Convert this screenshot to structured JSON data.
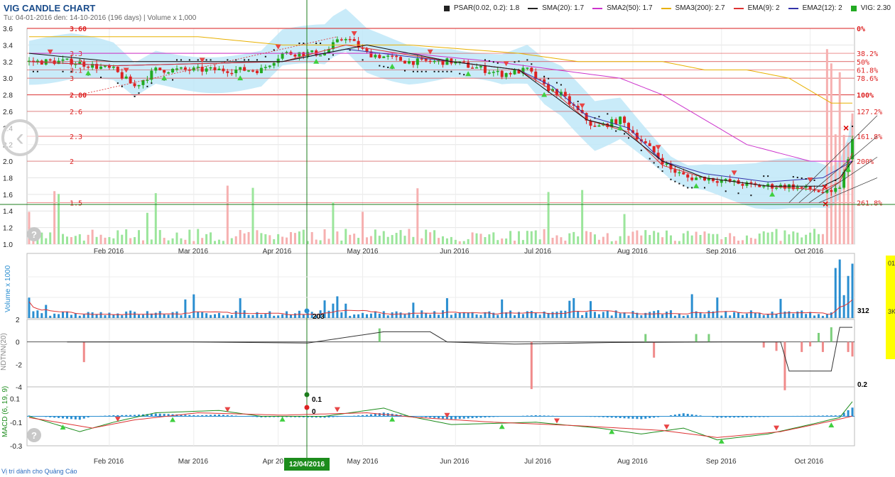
{
  "header": {
    "title": "VIG CANDLE CHART",
    "subtitle": "Tu: 04-01-2016 den: 14-10-2016 (196 days) | Volume x 1,000"
  },
  "legend": [
    {
      "label": "PSAR(0.02, 0.2): 1.8",
      "color": "#222222",
      "kind": "square"
    },
    {
      "label": "SMA(20): 1.7",
      "color": "#222222",
      "kind": "line"
    },
    {
      "label": "SMA2(50): 1.7",
      "color": "#cc33cc",
      "kind": "line"
    },
    {
      "label": "SMA3(200): 2.7",
      "color": "#e8b000",
      "kind": "line"
    },
    {
      "label": "EMA(9): 2",
      "color": "#dd3333",
      "kind": "line"
    },
    {
      "label": "EMA2(12): 2",
      "color": "#3333aa",
      "kind": "line"
    },
    {
      "label": "VIG: 2.30",
      "color": "#22aa22",
      "kind": "square"
    }
  ],
  "footer": {
    "text": "Vị trí dành cho Quảng Cáo"
  },
  "crosshair": {
    "date_label": "12/04/2016"
  },
  "right_panel": {
    "top_text": "01",
    "mid_text": "3K"
  },
  "colors": {
    "up": "#22aa22",
    "down": "#dd2222",
    "fib": "#dd2222",
    "cloud": "#bfe8f8"
  },
  "chart_data": [
    {
      "type": "candlestick",
      "name": "price",
      "ylim": [
        1.0,
        3.6
      ],
      "yticks": [
        "1.0",
        "1.2",
        "1.4",
        "1.6",
        "1.8",
        "2.0",
        "2.2",
        "2.4",
        "2.6",
        "2.8",
        "3.0",
        "3.2",
        "3.4",
        "3.6"
      ],
      "xticks": [
        "Feb 2016",
        "Mar 2016",
        "Apr 2016",
        "May 2016",
        "Jun 2016",
        "Jul 2016",
        "Aug 2016",
        "Sep 2016",
        "Oct 2016"
      ],
      "close_path": [
        [
          0,
          3.2
        ],
        [
          10,
          3.2
        ],
        [
          20,
          3.1
        ],
        [
          25,
          2.9
        ],
        [
          30,
          3.1
        ],
        [
          40,
          3.1
        ],
        [
          55,
          3.1
        ],
        [
          60,
          3.3
        ],
        [
          70,
          3.3
        ],
        [
          72,
          3.4
        ],
        [
          75,
          3.5
        ],
        [
          80,
          3.3
        ],
        [
          90,
          3.2
        ],
        [
          100,
          3.2
        ],
        [
          108,
          3.1
        ],
        [
          112,
          3.05
        ],
        [
          118,
          3.1
        ],
        [
          122,
          2.9
        ],
        [
          126,
          2.8
        ],
        [
          130,
          2.6
        ],
        [
          134,
          2.4
        ],
        [
          140,
          2.5
        ],
        [
          144,
          2.3
        ],
        [
          148,
          2.1
        ],
        [
          152,
          1.9
        ],
        [
          156,
          1.8
        ],
        [
          160,
          1.8
        ],
        [
          166,
          1.75
        ],
        [
          172,
          1.7
        ],
        [
          180,
          1.7
        ],
        [
          186,
          1.65
        ],
        [
          190,
          1.6
        ],
        [
          192,
          1.7
        ],
        [
          194,
          2.0
        ],
        [
          195,
          2.3
        ]
      ],
      "ohlc_last": {
        "close": 2.3
      },
      "fib_levels": [
        {
          "label": "0%",
          "value": 3.6
        },
        {
          "label": "38.2%",
          "value": 3.3
        },
        {
          "label": "50%",
          "value": 3.2
        },
        {
          "label": "61.8%",
          "value": 3.1
        },
        {
          "label": "78.6%",
          "value": 3.0
        },
        {
          "label": "100%",
          "value": 2.8
        },
        {
          "label": "127.2%",
          "value": 2.6
        },
        {
          "label": "161.8%",
          "value": 2.3
        },
        {
          "label": "200%",
          "value": 2.0
        },
        {
          "label": "261.8%",
          "value": 1.5
        }
      ],
      "price_labels": [
        {
          "text": "3.60",
          "value": 3.6
        },
        {
          "text": "3.3",
          "value": 3.3
        },
        {
          "text": "3.2",
          "value": 3.2
        },
        {
          "text": "3.1",
          "value": 3.1
        },
        {
          "text": "3",
          "value": 3.0
        },
        {
          "text": "2.80",
          "value": 2.8
        },
        {
          "text": "2.6",
          "value": 2.6
        },
        {
          "text": "2.3",
          "value": 2.3
        },
        {
          "text": "2",
          "value": 2.0
        },
        {
          "text": "1.5",
          "value": 1.5
        }
      ],
      "sma3_path": [
        [
          0,
          3.5
        ],
        [
          40,
          3.5
        ],
        [
          60,
          3.4
        ],
        [
          90,
          3.4
        ],
        [
          116,
          3.3
        ],
        [
          130,
          3.2
        ],
        [
          150,
          3.2
        ],
        [
          160,
          3.1
        ],
        [
          170,
          3.1
        ],
        [
          180,
          3.0
        ],
        [
          190,
          2.7
        ],
        [
          195,
          2.7
        ]
      ],
      "sma2_path": [
        [
          0,
          3.3
        ],
        [
          40,
          3.3
        ],
        [
          60,
          3.3
        ],
        [
          90,
          3.3
        ],
        [
          110,
          3.2
        ],
        [
          125,
          3.1
        ],
        [
          140,
          3.0
        ],
        [
          150,
          2.8
        ],
        [
          160,
          2.5
        ],
        [
          170,
          2.2
        ],
        [
          185,
          2.0
        ],
        [
          195,
          2.0
        ]
      ],
      "sma_path": [
        [
          0,
          3.3
        ],
        [
          20,
          3.2
        ],
        [
          60,
          3.2
        ],
        [
          80,
          3.4
        ],
        [
          100,
          3.2
        ],
        [
          116,
          3.1
        ],
        [
          124,
          2.8
        ],
        [
          132,
          2.5
        ],
        [
          140,
          2.4
        ],
        [
          150,
          2.0
        ],
        [
          160,
          1.8
        ],
        [
          175,
          1.7
        ],
        [
          188,
          1.7
        ],
        [
          192,
          1.8
        ],
        [
          195,
          2.0
        ]
      ],
      "ema_path": [
        [
          0,
          3.2
        ],
        [
          20,
          3.15
        ],
        [
          60,
          3.2
        ],
        [
          75,
          3.4
        ],
        [
          100,
          3.2
        ],
        [
          116,
          3.1
        ],
        [
          124,
          2.85
        ],
        [
          132,
          2.5
        ],
        [
          142,
          2.35
        ],
        [
          150,
          1.95
        ],
        [
          160,
          1.8
        ],
        [
          175,
          1.7
        ],
        [
          188,
          1.65
        ],
        [
          192,
          1.75
        ],
        [
          195,
          2.1
        ]
      ],
      "ema2_path": [
        [
          0,
          3.2
        ],
        [
          20,
          3.15
        ],
        [
          60,
          3.2
        ],
        [
          75,
          3.35
        ],
        [
          100,
          3.2
        ],
        [
          116,
          3.1
        ],
        [
          124,
          2.9
        ],
        [
          132,
          2.55
        ],
        [
          142,
          2.4
        ],
        [
          150,
          2.0
        ],
        [
          160,
          1.85
        ],
        [
          175,
          1.75
        ],
        [
          188,
          1.8
        ],
        [
          195,
          2.0
        ]
      ]
    },
    {
      "type": "bar",
      "name": "Volume x 1000",
      "ylabel": "Volume x 1000",
      "last_value": "312",
      "crosshair_value": "203"
    },
    {
      "type": "bar",
      "name": "NDTNN(20)",
      "ylabel": "NDTNN(20)",
      "ylim": [
        -4,
        2
      ],
      "yticks": [
        "2",
        "0",
        "-2",
        "-4"
      ]
    },
    {
      "type": "line",
      "name": "MACD (6, 19, 9)",
      "ylabel": "MACD (6, 19, 9)",
      "ylim": [
        -0.3,
        0.2
      ],
      "yticks": [
        "0.1",
        "-0.1",
        "-0.3"
      ],
      "crosshair_values": [
        "0.1",
        "0"
      ],
      "last_value": "0.2"
    }
  ]
}
